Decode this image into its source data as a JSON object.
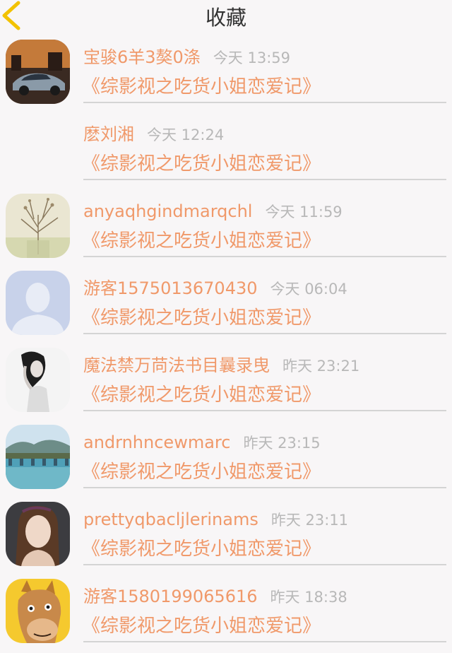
{
  "navbar": {
    "title": "收藏",
    "back_icon": "chevron-left-icon",
    "accent": "#f2c200"
  },
  "items": [
    {
      "user": "宝骏6羊3獒0涤",
      "time": "今天 13:59",
      "book": "《综影视之吃货小姐恋爱记》",
      "avatar": "car"
    },
    {
      "user": "麽刘湘",
      "time": "今天 12:24",
      "book": "《综影视之吃货小姐恋爱记》",
      "avatar": "none"
    },
    {
      "user": "anyaqhgindmarqchl",
      "time": "今天 11:59",
      "book": "《综影视之吃货小姐恋爱记》",
      "avatar": "dried-flowers"
    },
    {
      "user": "游客1575013670430",
      "time": "今天 06:04",
      "book": "《综影视之吃货小姐恋爱记》",
      "avatar": "default-person"
    },
    {
      "user": "魔法禁万苘法书目曩录曳",
      "time": "昨天 23:21",
      "book": "《综影视之吃货小姐恋爱记》",
      "avatar": "woman-bw"
    },
    {
      "user": "andrnhncewmarc",
      "time": "昨天 23:15",
      "book": "《综影视之吃货小姐恋爱记》",
      "avatar": "bridge-lake"
    },
    {
      "user": "prettyqbacljlerinams",
      "time": "昨天 23:11",
      "book": "《综影视之吃货小姐恋爱记》",
      "avatar": "girl-portrait"
    },
    {
      "user": "游客1580199065616",
      "time": "昨天 18:38",
      "book": "《综影视之吃货小姐恋爱记》",
      "avatar": "cartoon-horse"
    }
  ],
  "colors": {
    "username": "#f0996a",
    "book": "#f0996a",
    "time": "#b8b8b8",
    "separator": "#d4d4d4",
    "background": "#f8f6f7"
  }
}
